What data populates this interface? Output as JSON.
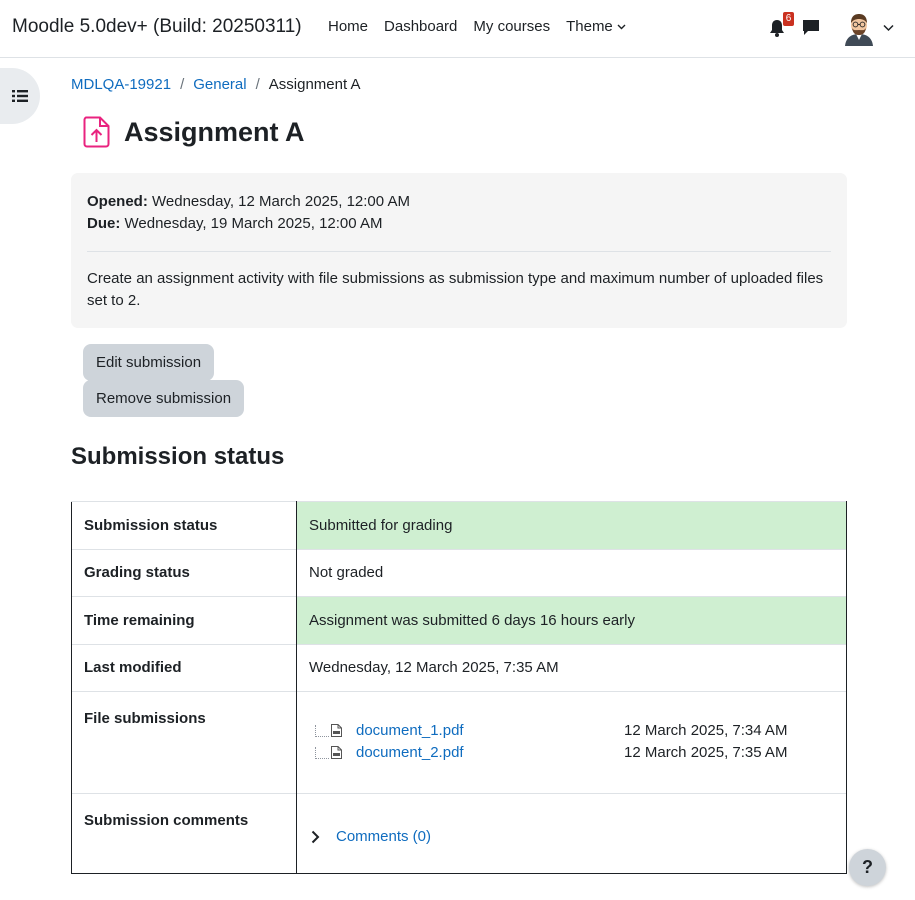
{
  "navbar": {
    "site_name": "Moodle 5.0dev+ (Build: 20250311)",
    "links": [
      "Home",
      "Dashboard",
      "My courses",
      "Theme"
    ],
    "notification_count": "6"
  },
  "breadcrumb": {
    "items": [
      "MDLQA-19921",
      "General"
    ],
    "current": "Assignment A",
    "separator": "/"
  },
  "page": {
    "title": "Assignment A"
  },
  "activity": {
    "opened_label": "Opened:",
    "opened_value": "Wednesday, 12 March 2025, 12:00 AM",
    "due_label": "Due:",
    "due_value": "Wednesday, 19 March 2025, 12:00 AM",
    "intro": "Create an assignment activity with file submissions as submission type and maximum number of uploaded files set to 2."
  },
  "actions": {
    "edit": "Edit submission",
    "remove": "Remove submission"
  },
  "submission": {
    "heading": "Submission status",
    "rows": [
      {
        "label": "Submission status",
        "value": "Submitted for grading"
      },
      {
        "label": "Grading status",
        "value": "Not graded"
      },
      {
        "label": "Time remaining",
        "value": "Assignment was submitted 6 days 16 hours early"
      },
      {
        "label": "Last modified",
        "value": "Wednesday, 12 March 2025, 7:35 AM"
      },
      {
        "label": "File submissions"
      },
      {
        "label": "Submission comments"
      }
    ],
    "files": [
      {
        "name": "document_1.pdf",
        "date": "12 March 2025, 7:34 AM"
      },
      {
        "name": "document_2.pdf",
        "date": "12 March 2025, 7:35 AM"
      }
    ],
    "comments_link": "Comments (0)"
  },
  "help": "?",
  "colors": {
    "link": "#0f6cbf",
    "success_bg": "#cfefd1",
    "button_bg": "#ced4da",
    "badge": "#ca3120",
    "assign_icon": "#e9237f"
  },
  "icons": [
    "bell-icon",
    "chat-icon",
    "user-avatar",
    "chevron-down-icon",
    "index-drawer-icon",
    "assignment-upload-icon",
    "pdf-file-icon",
    "chevron-right-icon",
    "help-icon"
  ]
}
